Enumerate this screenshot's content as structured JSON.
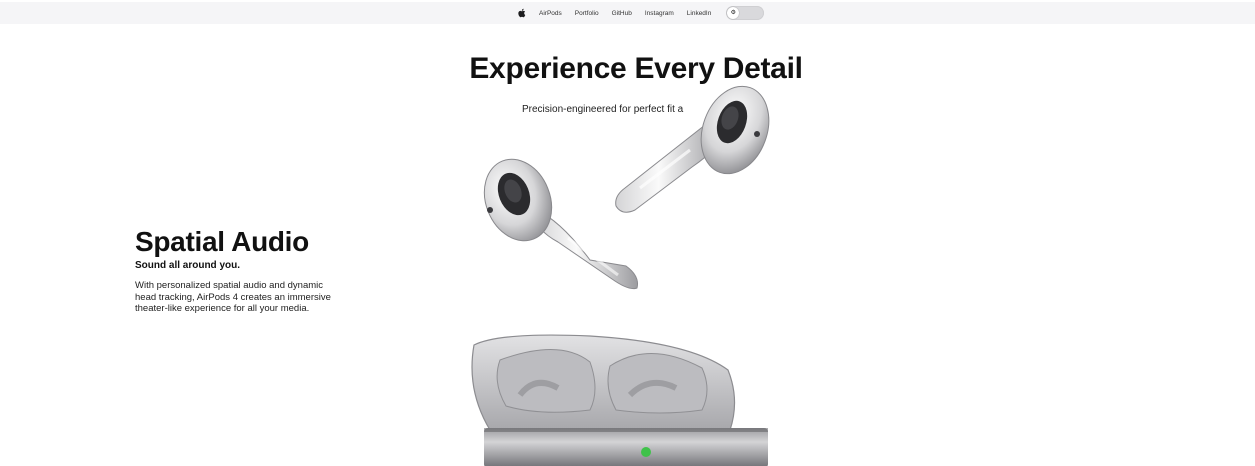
{
  "nav": {
    "logo_icon": "apple-icon",
    "links": [
      "AirPods",
      "Portfolio",
      "GitHub",
      "Instagram",
      "LinkedIn"
    ],
    "toggle_icon": "gear-icon",
    "toggle_glyph": "⚙"
  },
  "hero": {
    "title": "Experience Every Detail",
    "subtitle": "Precision-engineered for perfect fit a"
  },
  "feature": {
    "title": "Spatial Audio",
    "tagline": "Sound all around you.",
    "description": "With personalized spatial audio and dynamic head tracking, AirPods 4 creates an immersive theater-like experience for all your media."
  },
  "colors": {
    "nav_background": "#f5f5f7",
    "status_led": "#3fc24a"
  }
}
